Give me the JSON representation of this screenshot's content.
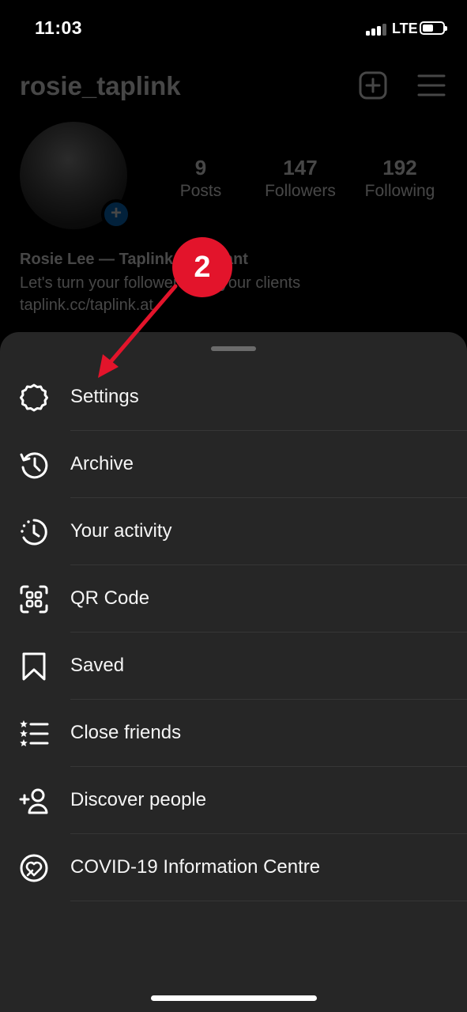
{
  "status_bar": {
    "time": "11:03",
    "network": "LTE"
  },
  "profile": {
    "username": "rosie_taplink",
    "stats": [
      {
        "value": "9",
        "label": "Posts"
      },
      {
        "value": "147",
        "label": "Followers"
      },
      {
        "value": "192",
        "label": "Following"
      }
    ],
    "bio_name": "Rosie Lee — Taplink Assistant",
    "bio_text": "Let's turn your followers into your clients",
    "bio_link": "taplink.cc/taplink.at"
  },
  "annotation": {
    "step": "2",
    "color": "#e3142b"
  },
  "menu": {
    "items": [
      {
        "label": "Settings",
        "icon": "settings-gear-icon"
      },
      {
        "label": "Archive",
        "icon": "archive-history-icon"
      },
      {
        "label": "Your activity",
        "icon": "activity-clock-icon"
      },
      {
        "label": "QR Code",
        "icon": "qr-code-icon"
      },
      {
        "label": "Saved",
        "icon": "bookmark-icon"
      },
      {
        "label": "Close friends",
        "icon": "close-friends-list-icon"
      },
      {
        "label": "Discover people",
        "icon": "add-person-icon"
      },
      {
        "label": "COVID-19 Information Centre",
        "icon": "covid-heart-icon"
      }
    ]
  },
  "colors": {
    "sheet_bg": "#262626",
    "background": "#000000",
    "accent_blue": "#0a77d4"
  }
}
